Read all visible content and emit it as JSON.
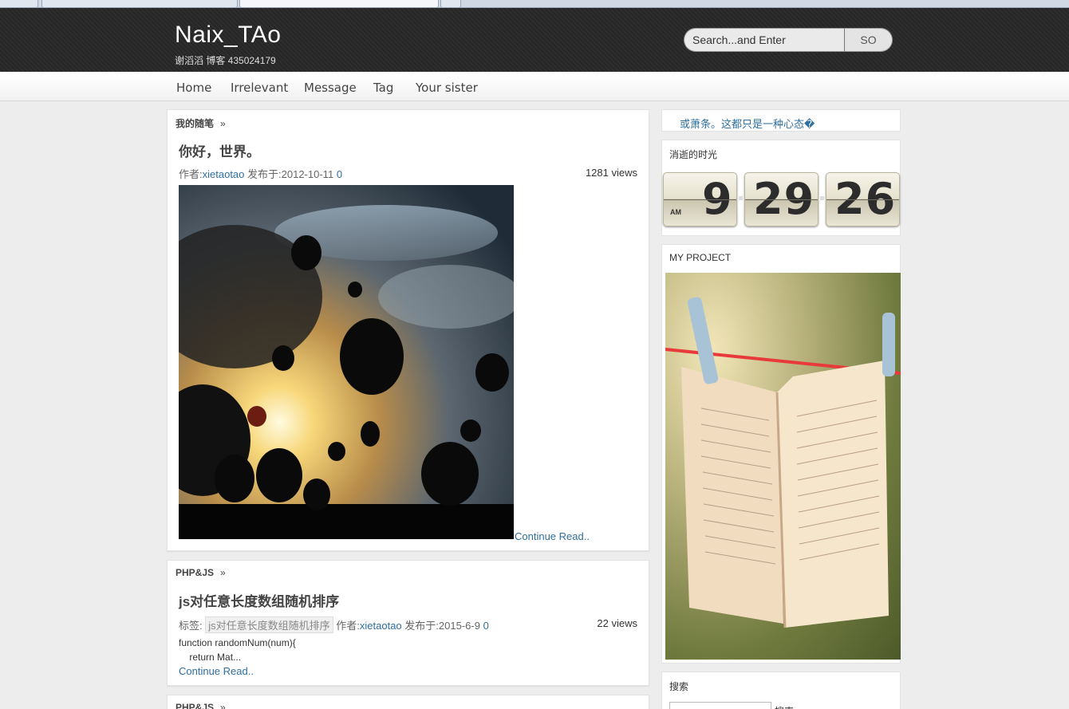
{
  "header": {
    "site_title": "Naix_TAo",
    "site_subtitle": "谢滔滔 博客 435024179",
    "search_placeholder": "Search...and Enter",
    "search_button": "SO"
  },
  "nav": {
    "items": [
      "Home",
      "Irrelevant",
      "Message",
      "Tag",
      "Your sister"
    ]
  },
  "posts": [
    {
      "category": "我的随笔",
      "raquo": "»",
      "title": "你好，世界。",
      "author_label": "作者:",
      "author": "xietaotao",
      "date_label": "发布于:",
      "date": "2012-10-11",
      "comments": "0",
      "views": "1281 views",
      "continue": "Continue Read.."
    },
    {
      "category": "PHP&JS",
      "raquo": "»",
      "title": "js对任意长度数组随机排序",
      "tag_label": "标签:",
      "tag": "js对任意长度数组随机排序",
      "author_label": "作者:",
      "author": "xietaotao",
      "date_label": "发布于:",
      "date": "2015-6-9",
      "comments": "0",
      "views": "22 views",
      "excerpt_line1": "function randomNum(num){",
      "excerpt_line2": "    return Mat...",
      "continue": "Continue Read.."
    },
    {
      "category": "PHP&JS",
      "raquo": "»"
    }
  ],
  "sidebar": {
    "marquee": "或萧条。这都只是一种心态�",
    "clock_title": "消逝的时光",
    "clock": {
      "ampm": "AM",
      "hour": "9",
      "minute": "29",
      "second": "26"
    },
    "project_title": "MY PROJECT",
    "search_title": "搜索",
    "search_button_partial": "搜索"
  },
  "icons": {
    "post_image": "hot-air-balloons-photo",
    "project_image": "open-book-on-clothesline-photo"
  }
}
